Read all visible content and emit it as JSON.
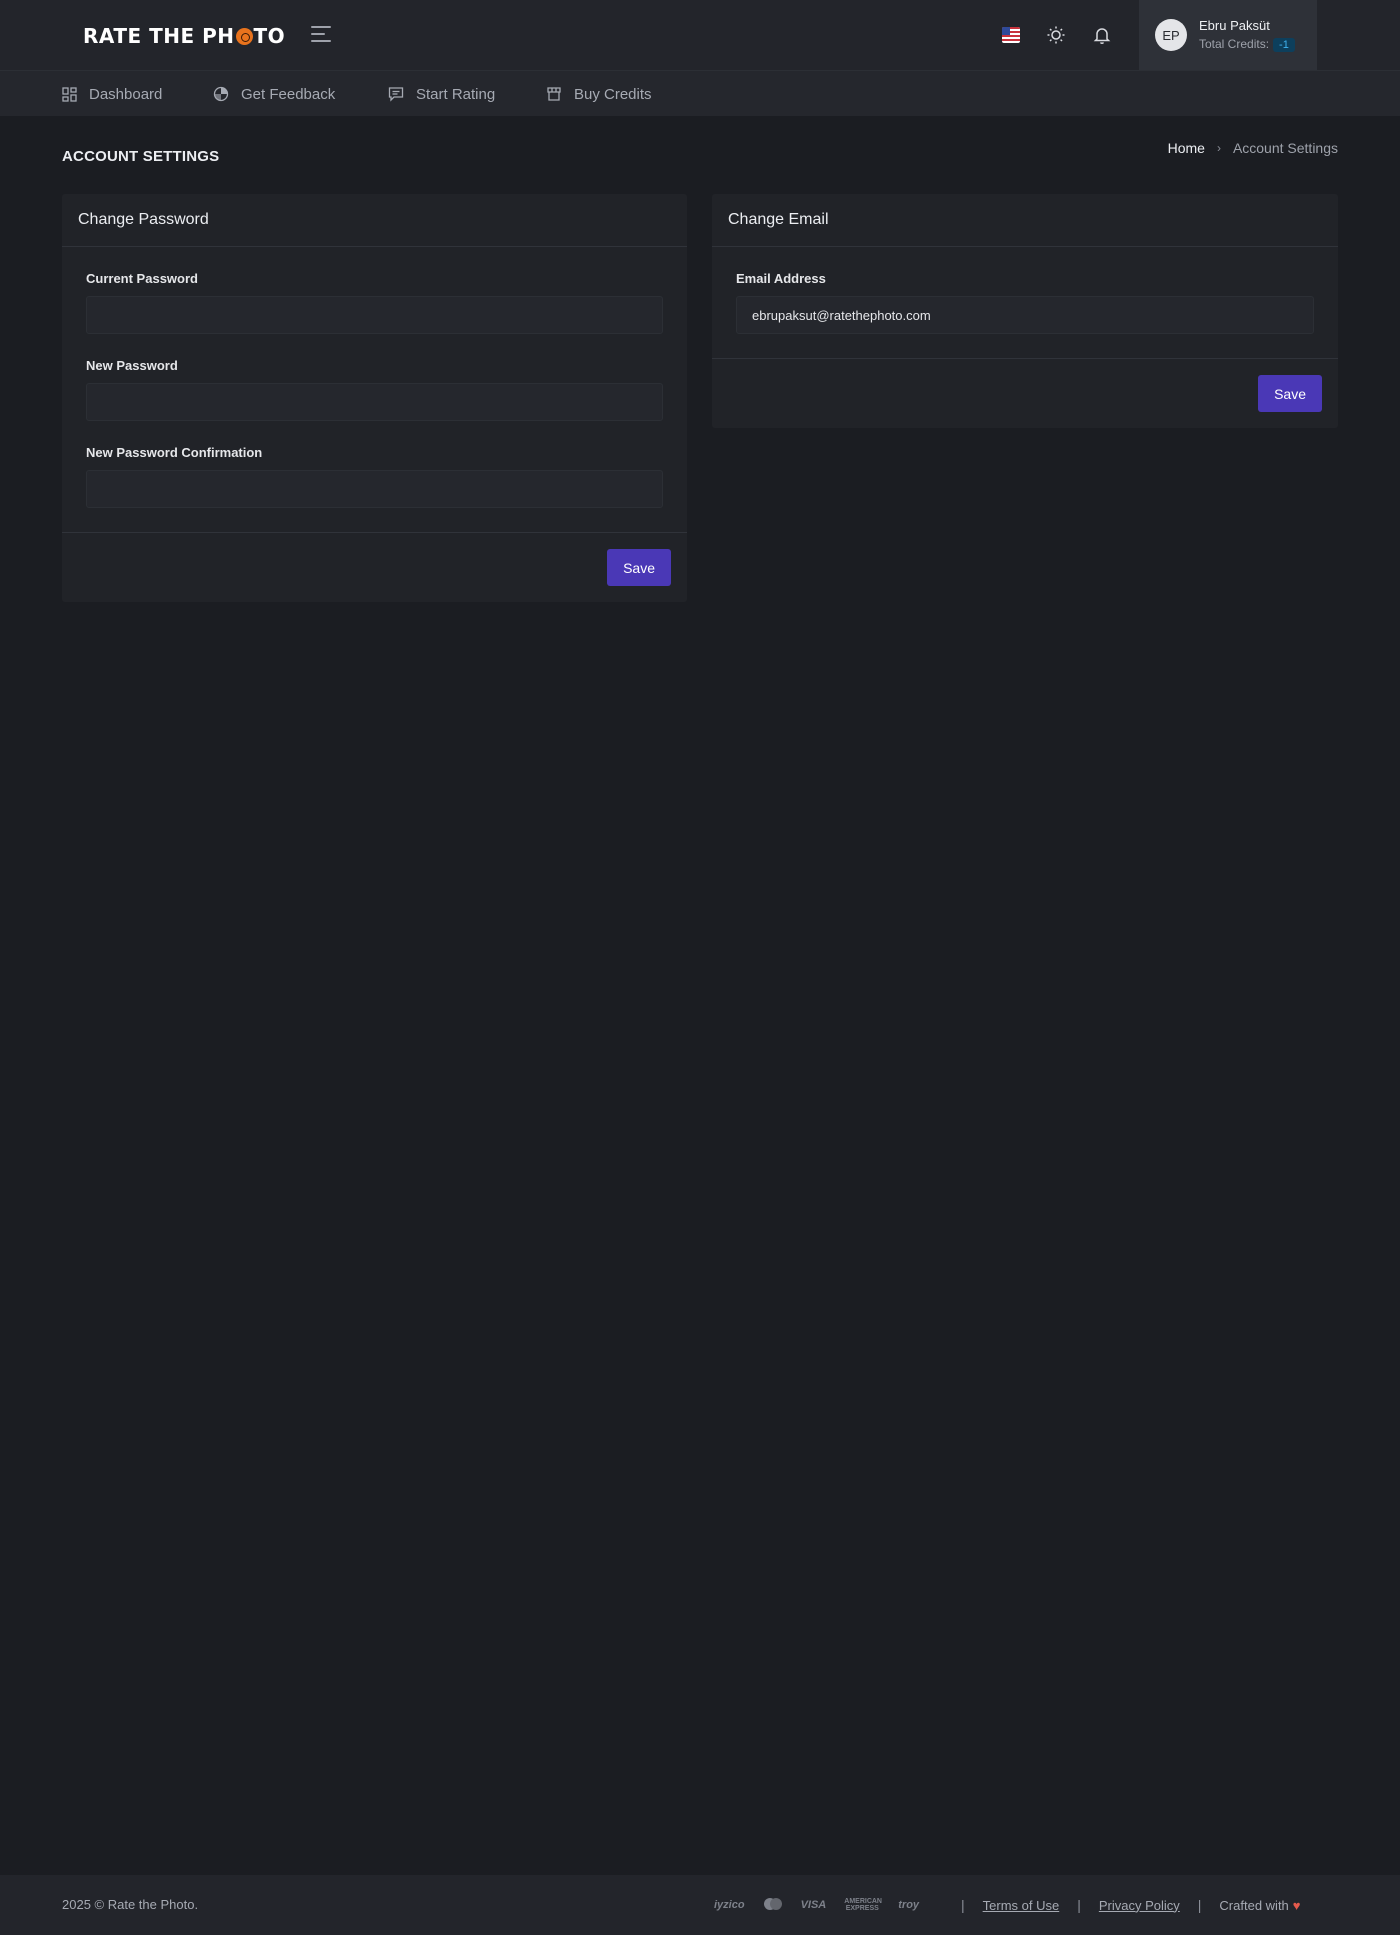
{
  "header": {
    "logo_text_before": "RATE THE PH",
    "logo_text_after": "TO",
    "user": {
      "initials": "EP",
      "name": "Ebru Paksüt",
      "credits_label": "Total Credits:",
      "credits_value": "-1"
    },
    "icons": [
      "menu-icon",
      "us-flag-icon",
      "sun-icon",
      "bell-icon"
    ]
  },
  "nav": {
    "items": [
      {
        "label": "Dashboard",
        "icon": "dashboard-icon"
      },
      {
        "label": "Get Feedback",
        "icon": "pie-chart-icon"
      },
      {
        "label": "Start Rating",
        "icon": "chat-icon"
      },
      {
        "label": "Buy Credits",
        "icon": "store-icon"
      }
    ]
  },
  "page": {
    "title": "ACCOUNT SETTINGS",
    "breadcrumb": {
      "home": "Home",
      "current": "Account Settings"
    }
  },
  "change_password": {
    "title": "Change Password",
    "fields": [
      {
        "label": "Current Password",
        "value": ""
      },
      {
        "label": "New Password",
        "value": ""
      },
      {
        "label": "New Password Confirmation",
        "value": ""
      }
    ],
    "save_label": "Save"
  },
  "change_email": {
    "title": "Change Email",
    "field_label": "Email Address",
    "value": "ebrupaksut@ratethephoto.com",
    "save_label": "Save"
  },
  "footer": {
    "copyright": "2025 © Rate the Photo.",
    "payment_logos": [
      "iyzico",
      "mastercard",
      "VISA",
      "AMERICAN EXPRESS",
      "troy"
    ],
    "terms": "Terms of Use",
    "privacy": "Privacy Policy",
    "crafted": "Crafted with",
    "heart": "♥"
  },
  "colors": {
    "background": "#1b1d22",
    "card": "#212328",
    "accent": "#4a38b6",
    "logo_accent": "#e8731d"
  }
}
